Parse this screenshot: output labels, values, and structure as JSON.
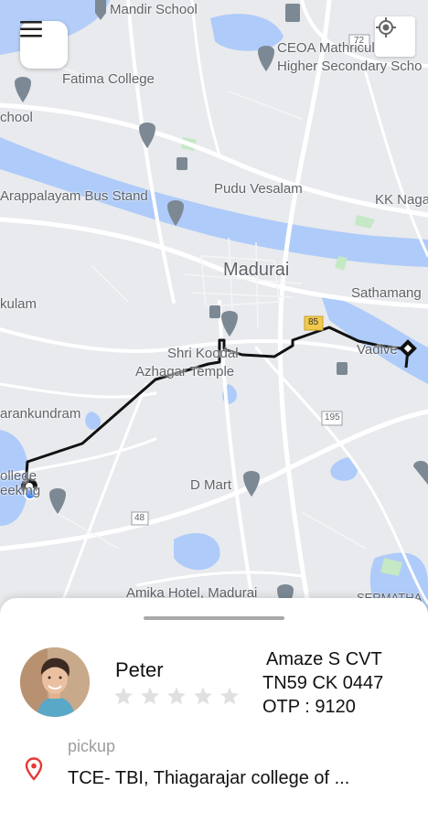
{
  "map": {
    "labels": {
      "mandir_school": "Mandir School",
      "ceoa": "CEOA Mathriculation",
      "higher_sec": "Higher Secondary Scho",
      "fatima": "Fatima College",
      "school_left": "chool",
      "arappalayam": "Arappalayam Bus Stand",
      "pudu": "Pudu Vesalam",
      "kk_nagar": "KK Naga",
      "madurai": "Madurai",
      "sathamang": "Sathamang",
      "kulam": "kulam",
      "shri_koodal": "Shri Koodal",
      "azhagar": "Azhagar Temple",
      "vadive": "Vadive",
      "parankundram": "arankundram",
      "college": "ollege",
      "eeking": "eeking",
      "d_mart": "D Mart",
      "amika": "Amika Hotel, Madurai",
      "sermatha": "SERMATHA",
      "road_72": "72",
      "road_85": "85",
      "road_195": "195",
      "road_48": "48"
    },
    "colors": {
      "water": "#aecbfa",
      "road": "#ffffff",
      "green": "#c5e8c5",
      "route": "#111111",
      "poi": "#7c8994"
    }
  },
  "controls": {
    "menu_icon": "hamburger-menu-icon",
    "location_icon": "my-location-icon"
  },
  "driver": {
    "name": "Peter",
    "rating": 0,
    "rating_max": 5,
    "car_model": "Amaze S CVT",
    "plate": "TN59 CK 0447",
    "otp_text": "OTP :  9120"
  },
  "pickup": {
    "label": "pickup",
    "address": "TCE- TBI, Thiagarajar college of ..."
  }
}
